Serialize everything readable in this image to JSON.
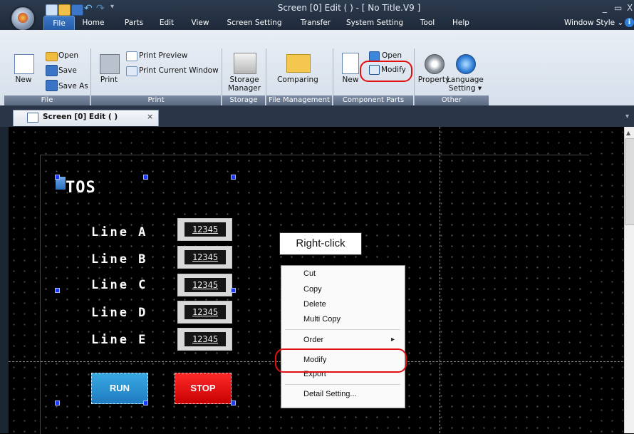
{
  "window": {
    "title": "Screen [0] Edit (                 ) - [ No Title.V9 ]",
    "minimize": "_",
    "restore": "▭",
    "close": "X"
  },
  "ribbon_tabs": [
    "File",
    "Home",
    "Parts",
    "Edit",
    "View",
    "Screen Setting",
    "Transfer",
    "System Setting",
    "Tool",
    "Help"
  ],
  "window_style": "Window Style",
  "file_group": {
    "label": "File",
    "new": "New",
    "open": "Open",
    "save": "Save",
    "save_as": "Save As"
  },
  "print_group": {
    "label": "Print",
    "print": "Print",
    "preview": "Print Preview",
    "current_window": "Print Current Window"
  },
  "storage_group": {
    "label": "Storage",
    "manager_line1": "Storage",
    "manager_line2": "Manager"
  },
  "file_mgmt_group": {
    "label": "File Management",
    "comparing": "Comparing"
  },
  "component_group": {
    "label": "Component Parts",
    "new": "New",
    "open": "Open",
    "modify": "Modify"
  },
  "other_group": {
    "label": "Other",
    "property": "Property",
    "language_line1": "Language",
    "language_line2": "Setting"
  },
  "doc_tab": {
    "label": "Screen [0] Edit (           )",
    "close": "×"
  },
  "screen": {
    "title": "TOS",
    "lines": [
      {
        "label": "Line A",
        "value": "12345"
      },
      {
        "label": "Line B",
        "value": "12345"
      },
      {
        "label": "Line C",
        "value": "12345"
      },
      {
        "label": "Line D",
        "value": "12345"
      },
      {
        "label": "Line E",
        "value": "12345"
      }
    ],
    "run": "RUN",
    "stop": "STOP"
  },
  "callout": "Right-click",
  "context_menu": {
    "items": [
      "Cut",
      "Copy",
      "Delete",
      "Multi Copy",
      "Order",
      "Modify",
      "Export",
      "Detail Setting..."
    ],
    "submenu_arrow": "▸"
  },
  "colors": {
    "highlight_ring": "#e01010",
    "run": "#1e8fd6",
    "stop": "#e00000"
  },
  "icons": [
    "app-orb-icon",
    "new-file-icon",
    "open-folder-icon",
    "save-icon",
    "save-as-icon",
    "printer-icon",
    "print-preview-icon",
    "print-window-icon",
    "storage-manager-icon",
    "comparing-folder-icon",
    "component-new-icon",
    "component-open-icon",
    "component-modify-icon",
    "property-gear-icon",
    "language-globe-icon",
    "info-icon"
  ]
}
